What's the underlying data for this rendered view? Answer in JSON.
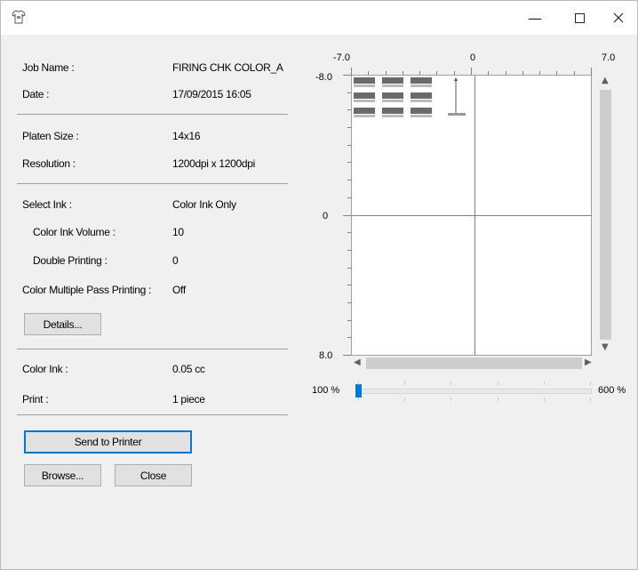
{
  "window": {
    "icon": "tshirt-icon",
    "controls": {
      "minimize": "—",
      "maximize": "☐",
      "close": "✕"
    }
  },
  "info": {
    "job_name_label": "Job Name :",
    "job_name_value": "FIRING CHK COLOR_A",
    "date_label": "Date :",
    "date_value": "17/09/2015 16:05",
    "platen_label": "Platen Size :",
    "platen_value": "14x16",
    "resolution_label": "Resolution :",
    "resolution_value": "1200dpi x 1200dpi",
    "select_ink_label": "Select Ink :",
    "select_ink_value": "Color Ink Only",
    "color_ink_volume_label": "Color Ink Volume :",
    "color_ink_volume_value": "10",
    "double_printing_label": "Double Printing :",
    "double_printing_value": "0",
    "multi_pass_label": "Color Multiple Pass Printing :",
    "multi_pass_value": "Off",
    "color_ink_label": "Color Ink :",
    "color_ink_value": "0.05 cc",
    "print_label": "Print :",
    "print_value": "1 piece"
  },
  "buttons": {
    "details": "Details...",
    "send": "Send to Printer",
    "browse": "Browse...",
    "close": "Close"
  },
  "preview": {
    "x_min": "-7.0",
    "x_mid": "0",
    "x_max": "7.0",
    "y_min": "-8.0",
    "y_mid": "0",
    "y_max": "8.0"
  },
  "zoom": {
    "min_label": "100 %",
    "max_label": "600 %",
    "level": 0
  }
}
